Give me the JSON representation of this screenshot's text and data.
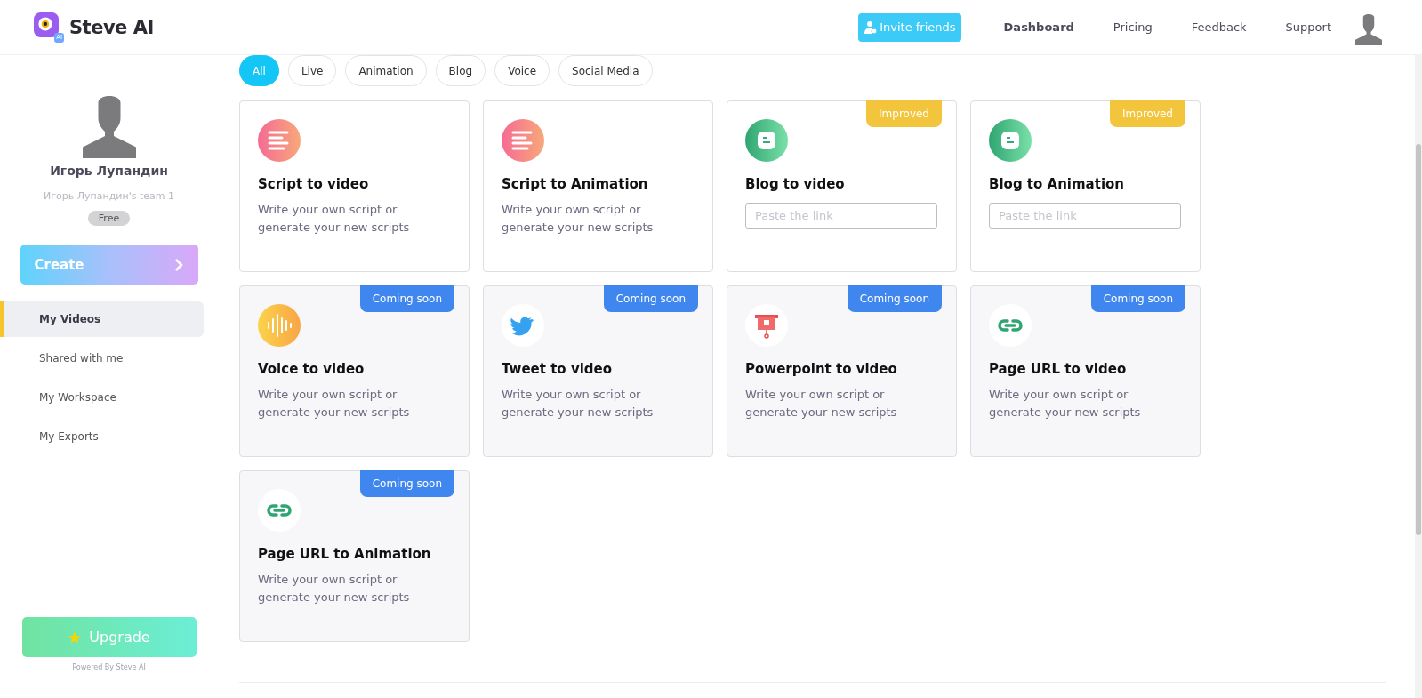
{
  "brand": {
    "name": "Steve AI",
    "logo_badge": "AI"
  },
  "nav": {
    "invite": "Invite friends",
    "links": [
      {
        "label": "Dashboard",
        "selected": true
      },
      {
        "label": "Pricing",
        "selected": false
      },
      {
        "label": "Feedback",
        "selected": false
      },
      {
        "label": "Support",
        "selected": false
      }
    ]
  },
  "profile": {
    "name": "Игорь Лупандин",
    "team": "Игорь Лупандин's team 1",
    "plan": "Free"
  },
  "create_button": "Create",
  "sidebar": {
    "items": [
      {
        "label": "My Videos",
        "selected": true
      },
      {
        "label": "Shared with me",
        "selected": false
      },
      {
        "label": "My Workspace",
        "selected": false
      },
      {
        "label": "My Exports",
        "selected": false
      }
    ]
  },
  "upgrade_button": "Upgrade",
  "powered_by": "Powered By Steve AI",
  "filters": [
    {
      "label": "All",
      "selected": true
    },
    {
      "label": "Live",
      "selected": false
    },
    {
      "label": "Animation",
      "selected": false
    },
    {
      "label": "Blog",
      "selected": false
    },
    {
      "label": "Voice",
      "selected": false
    },
    {
      "label": "Social Media",
      "selected": false
    }
  ],
  "cards": [
    {
      "kind": "script",
      "title": "Script to video",
      "text": "Write your own script or generate your new scripts"
    },
    {
      "kind": "script",
      "title": "Script to Animation",
      "text": "Write your own script or generate your new scripts"
    },
    {
      "kind": "blog",
      "title": "Blog to video",
      "placeholder": "Paste the link",
      "badge": {
        "kind": "improved",
        "label": "Improved"
      }
    },
    {
      "kind": "blog",
      "title": "Blog to Animation",
      "placeholder": "Paste the link",
      "badge": {
        "kind": "improved",
        "label": "Improved"
      }
    },
    {
      "kind": "voice",
      "title": "Voice to video",
      "text": "Write your own script or generate your new scripts",
      "badge": {
        "kind": "soon",
        "label": "Coming soon"
      }
    },
    {
      "kind": "tweet",
      "title": "Tweet to video",
      "text": "Write your own script or generate your new scripts",
      "badge": {
        "kind": "soon",
        "label": "Coming soon"
      }
    },
    {
      "kind": "slides",
      "title": "Powerpoint to video",
      "text": "Write your own script or generate your new scripts",
      "badge": {
        "kind": "soon",
        "label": "Coming soon"
      }
    },
    {
      "kind": "link",
      "title": "Page URL to video",
      "text": "Write your own script or generate your new scripts",
      "badge": {
        "kind": "soon",
        "label": "Coming soon"
      }
    },
    {
      "kind": "link",
      "title": "Page URL to Animation",
      "text": "Write your own script or generate your new scripts",
      "badge": {
        "kind": "soon",
        "label": "Coming soon"
      }
    }
  ]
}
